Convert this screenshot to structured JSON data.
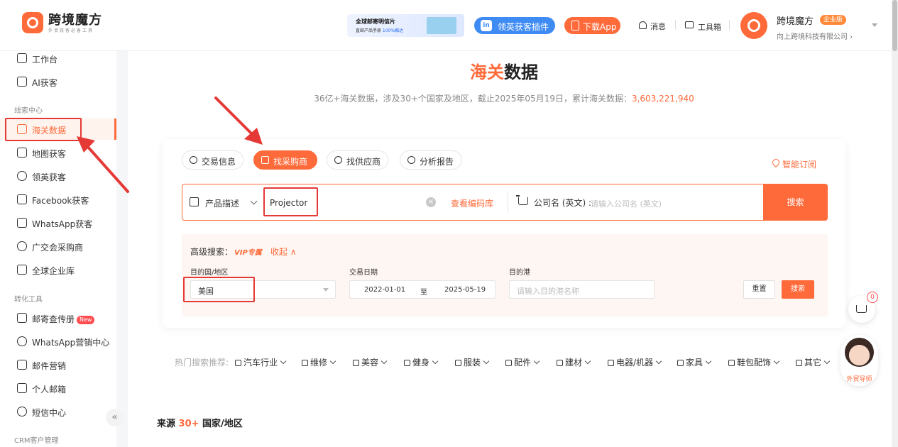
{
  "header": {
    "app_name": "跨境魔方",
    "app_tagline": "外贸获客必备工具",
    "banner": {
      "line1": "全球邮寄明信片",
      "line2_prefix": "直邮产品手册 ",
      "line2_highlight": "100%触达"
    },
    "linkedin_button": "领英获客插件",
    "download_button": "下载App",
    "messages": "消息",
    "toolbox": "工具箱",
    "user_name": "跨境魔方",
    "edition_badge": "企业版",
    "company": "向上跨境科技有限公司 ›"
  },
  "sidebar": {
    "items_top": [
      {
        "label": "工作台",
        "icon": "home-icon"
      },
      {
        "label": "AI获客",
        "icon": "robot-icon"
      }
    ],
    "section_leads": "线索中心",
    "items_leads": [
      {
        "label": "海关数据",
        "icon": "customs-icon",
        "active": true
      },
      {
        "label": "地图获客",
        "icon": "map-icon"
      },
      {
        "label": "领英获客",
        "icon": "user-search-icon"
      },
      {
        "label": "Facebook获客",
        "icon": "facebook-icon"
      },
      {
        "label": "WhatsApp获客",
        "icon": "whatsapp-icon"
      },
      {
        "label": "广交会采购商",
        "icon": "globe-icon"
      },
      {
        "label": "全球企业库",
        "icon": "building-icon"
      }
    ],
    "section_convert": "转化工具",
    "items_convert": [
      {
        "label": "邮寄查传册",
        "icon": "mail-icon",
        "badge": "New"
      },
      {
        "label": "WhatsApp营销中心",
        "icon": "whatsapp-icon"
      },
      {
        "label": "邮件营销",
        "icon": "email-icon"
      },
      {
        "label": "个人邮箱",
        "icon": "mailbox-icon"
      },
      {
        "label": "短信中心",
        "icon": "sms-icon"
      }
    ],
    "section_crm": "CRM客户管理",
    "collapse_glyph": "«"
  },
  "main": {
    "title_highlight": "海关",
    "title_rest": "数据",
    "subtitle_prefix": "36亿+海关数据，涉及30+个国家及地区，截止2025年05月19日，累计海关数据：",
    "subtitle_count": "3,603,221,940",
    "tabs": [
      {
        "label": "交易信息"
      },
      {
        "label": "找采购商",
        "active": true
      },
      {
        "label": "找供应商"
      },
      {
        "label": "分析报告"
      }
    ],
    "smart_subscribe": "智能订阅",
    "search": {
      "select_label": "产品描述",
      "keyword": "Projector",
      "code_library": "查看编码库",
      "company_label": "公司名 (英文) :",
      "company_placeholder": "请输入公司名 (英文)",
      "button": "搜索"
    },
    "advanced": {
      "title": "高级搜索：",
      "vip": "VIP专属",
      "collapse": "收起 ∧",
      "dest_label": "目的国/地区",
      "dest_value": "美国",
      "date_label": "交易日期",
      "date_from": "2022-01-01",
      "date_to_word": "至",
      "date_to": "2025-05-19",
      "port_label": "目的港",
      "port_placeholder": "请输入目的港名称",
      "reset": "重置",
      "search": "搜索"
    },
    "hot_label": "热门搜索推荐:",
    "hot_items": [
      "汽车行业",
      "维修",
      "美容",
      "健身",
      "服装",
      "配件",
      "建材",
      "电器/机器",
      "家具",
      "鞋包配饰",
      "其它"
    ],
    "source_prefix": "来源 ",
    "source_count": "30+",
    "source_suffix": " 国家/地区"
  },
  "floating": {
    "cart_count": "0",
    "advisor_label": "外贸导师"
  },
  "colors": {
    "accent": "#ff6a3a",
    "annotation": "#e53935"
  }
}
